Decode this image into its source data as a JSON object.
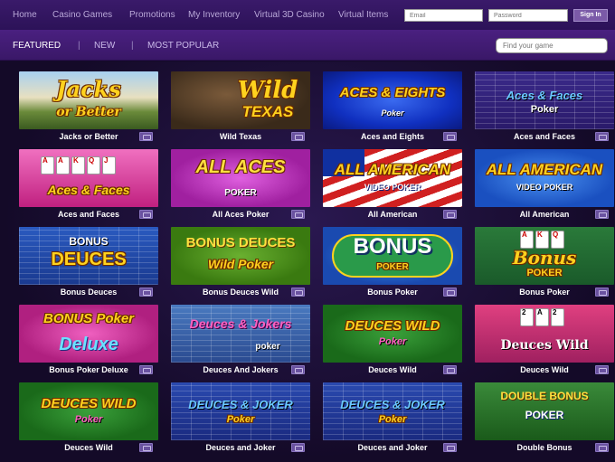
{
  "topnav": {
    "items": [
      "Home",
      "Casino Games",
      "Promotions",
      "My Inventory",
      "Virtual 3D Casino",
      "Virtual Items"
    ],
    "email_placeholder": "Email",
    "password_placeholder": "Password",
    "signin_label": "Sign In"
  },
  "subnav": {
    "tabs": [
      "FEATURED",
      "NEW",
      "MOST POPULAR"
    ],
    "separator": "|",
    "search_placeholder": "Find your game"
  },
  "games": [
    {
      "label": "Jacks or Better",
      "art_line1": "Jacks",
      "art_line2": "or Better"
    },
    {
      "label": "Wild Texas",
      "art_line1": "Wild",
      "art_line2": "TEXAS"
    },
    {
      "label": "Aces and Eights",
      "art_line1": "ACES & EIGHTS",
      "art_line2": "Poker"
    },
    {
      "label": "Aces and Faces",
      "art_line1": "Aces & Faces",
      "art_line2": "Poker"
    },
    {
      "label": "Aces and Faces",
      "art_line1": "Aces & Faces",
      "art_line2": ""
    },
    {
      "label": "All Aces Poker",
      "art_line1": "ALL ACES",
      "art_line2": "POKER"
    },
    {
      "label": "All American",
      "art_line1": "ALL AMERICAN",
      "art_line2": "VIDEO POKER"
    },
    {
      "label": "All American",
      "art_line1": "ALL AMERICAN",
      "art_line2": "VIDEO POKER"
    },
    {
      "label": "Bonus Deuces",
      "art_line1": "BONUS",
      "art_line2": "DEUCES"
    },
    {
      "label": "Bonus Deuces Wild",
      "art_line1": "BONUS DEUCES",
      "art_line2": "Wild Poker"
    },
    {
      "label": "Bonus Poker",
      "art_line1": "BONUS",
      "art_line2": "POKER"
    },
    {
      "label": "Bonus Poker",
      "art_line1": "Bonus",
      "art_line2": "POKER"
    },
    {
      "label": "Bonus Poker Deluxe",
      "art_line1": "BONUS Poker",
      "art_line2": "Deluxe"
    },
    {
      "label": "Deuces And Jokers",
      "art_line1": "Deuces & Jokers",
      "art_line2": "poker"
    },
    {
      "label": "Deuces Wild",
      "art_line1": "DEUCES WILD",
      "art_line2": "Poker"
    },
    {
      "label": "Deuces Wild",
      "art_line1": "Deuces Wild",
      "art_line2": ""
    },
    {
      "label": "Deuces Wild",
      "art_line1": "DEUCES WILD",
      "art_line2": "Poker"
    },
    {
      "label": "Deuces and Joker",
      "art_line1": "DEUCES & JOKER",
      "art_line2": "Poker"
    },
    {
      "label": "Deuces and Joker",
      "art_line1": "DEUCES & JOKER",
      "art_line2": "Poker"
    },
    {
      "label": "Double Bonus",
      "art_line1": "DOUBLE BONUS",
      "art_line2": "POKER"
    }
  ],
  "colors": {
    "background": "#150a2a",
    "nav": "#2c1258",
    "subnav": "#3a1868",
    "gold": "#ffd21e",
    "tile_icon": "#6a52a0"
  }
}
